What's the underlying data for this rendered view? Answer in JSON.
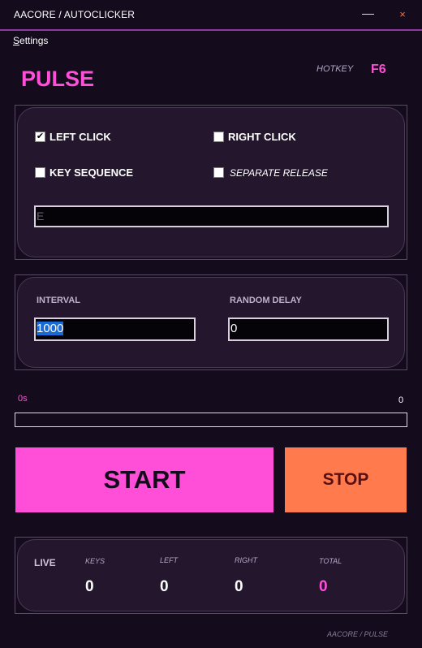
{
  "window": {
    "title": "AACORE / AUTOCLICKER",
    "minimize_glyph": "—",
    "close_glyph": "×"
  },
  "menu": {
    "settings_first": "S",
    "settings_rest": "ettings"
  },
  "header": {
    "title": "PULSE",
    "hotkey_label": "HOTKEY",
    "hotkey_value": "F6"
  },
  "mode": {
    "left_click": {
      "label": "LEFT CLICK",
      "checked": true
    },
    "right_click": {
      "label": "RIGHT CLICK",
      "checked": false
    },
    "key_sequence": {
      "label": "KEY SEQUENCE",
      "checked": false
    },
    "separate_release": {
      "label": "SEPARATE RELEASE",
      "checked": false
    },
    "keys_value": "E"
  },
  "timing": {
    "interval_label": "INTERVAL",
    "interval_value": "1000",
    "random_delay_label": "RANDOM DELAY",
    "random_delay_value": "0"
  },
  "progress": {
    "elapsed": "0s",
    "count": "0",
    "fraction": 0
  },
  "controls": {
    "start_label": "START",
    "stop_label": "STOP"
  },
  "live": {
    "label": "LIVE",
    "keys_label": "KEYS",
    "keys_value": "0",
    "left_label": "LEFT",
    "left_value": "0",
    "right_label": "RIGHT",
    "right_value": "0",
    "total_label": "TOTAL",
    "total_value": "0"
  },
  "footer": "AACORE / PULSE",
  "colors": {
    "accent": "#ff4fd8",
    "stop": "#ff7a4c",
    "background": "#140c1c",
    "panel": "#23162d"
  }
}
